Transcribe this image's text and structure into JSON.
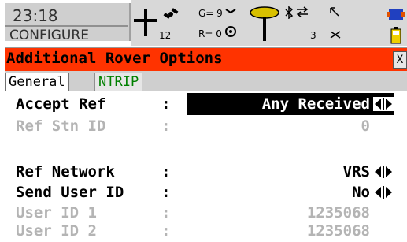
{
  "status": {
    "time": "23:18",
    "mode": "CONFIGURE",
    "sat_count": "12",
    "g_value": "G= 9",
    "r_value": "R= 0",
    "link_count": "3"
  },
  "window": {
    "title": "Additional Rover Options",
    "close_label": "X"
  },
  "tabs": [
    {
      "label": "General",
      "active": true
    },
    {
      "label": "NTRIP",
      "active": false
    }
  ],
  "fields": {
    "accept_ref": {
      "label": "Accept Ref",
      "value": "Any Received"
    },
    "ref_stn_id": {
      "label": "Ref Stn ID",
      "value": "0"
    },
    "ref_network": {
      "label": "Ref Network",
      "value": "VRS"
    },
    "send_user_id": {
      "label": "Send User ID",
      "value": "No"
    },
    "user_id_1": {
      "label": "User ID 1",
      "value": "1235068"
    },
    "user_id_2": {
      "label": "User ID 2",
      "value": "1235068"
    }
  },
  "colors": {
    "title_bar": "#ff3300",
    "tab_inactive_text": "#008000",
    "dim_text": "#b4b4b4"
  }
}
